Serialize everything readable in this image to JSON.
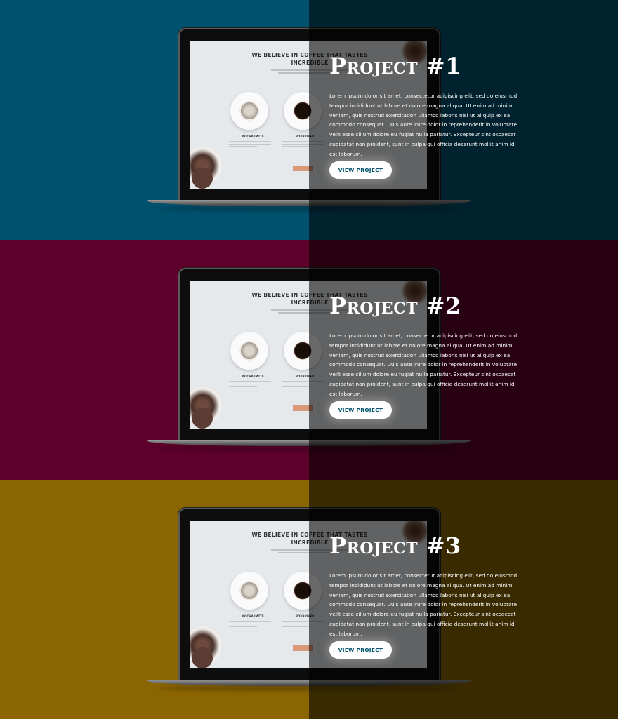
{
  "projects": [
    {
      "title": "Project #1",
      "body": "Lorem ipsum dolor sit amet, consectetur adipiscing elit, sed do eiusmod tempor incididunt ut labore et dolore magna aliqua. Ut enim ad minim veniam, quis nostrud exercitation ullamco laboris nisi ut aliquip ex ea commodo consequat. Duis aute irure dolor in reprehenderit in voluptate velit esse cillum dolore eu fugiat nulla pariatur. Excepteur sint occaecat cupidatat non proident, sunt in culpa qui officia deserunt mollit anim id est laborum.",
      "button_label": "VIEW PROJECT",
      "bg_color": "#00516e",
      "button_text_color": "#00516e"
    },
    {
      "title": "Project #2",
      "body": "Lorem ipsum dolor sit amet, consectetur adipiscing elit, sed do eiusmod tempor incididunt ut labore et dolore magna aliqua. Ut enim ad minim veniam, quis nostrud exercitation ullamco laboris nisi ut aliquip ex ea commodo consequat. Duis aute irure dolor in reprehenderit in voluptate velit esse cillum dolore eu fugiat nulla pariatur. Excepteur sint occaecat cupidatat non proident, sunt in culpa qui officia deserunt mollit anim id est laborum.",
      "button_label": "VIEW PROJECT",
      "bg_color": "#5e002c",
      "button_text_color": "#00516e"
    },
    {
      "title": "Project #3",
      "body": "Lorem ipsum dolor sit amet, consectetur adipiscing elit, sed do eiusmod tempor incididunt ut labore et dolore magna aliqua. Ut enim ad minim veniam, quis nostrud exercitation ullamco laboris nisi ut aliquip ex ea commodo consequat. Duis aute irure dolor in reprehenderit in voluptate velit esse cillum dolore eu fugiat nulla pariatur. Excepteur sint occaecat cupidatat non proident, sunt in culpa qui officia deserunt mollit anim id est laborum.",
      "button_label": "VIEW PROJECT",
      "bg_color": "#8b6500",
      "button_text_color": "#00516e"
    }
  ],
  "mockup": {
    "heading": "WE BELIEVE IN COFFEE THAT TASTES INCREDIBLE",
    "item1_label": "MOCHA LATTE",
    "item2_label": "POUR OVER"
  }
}
